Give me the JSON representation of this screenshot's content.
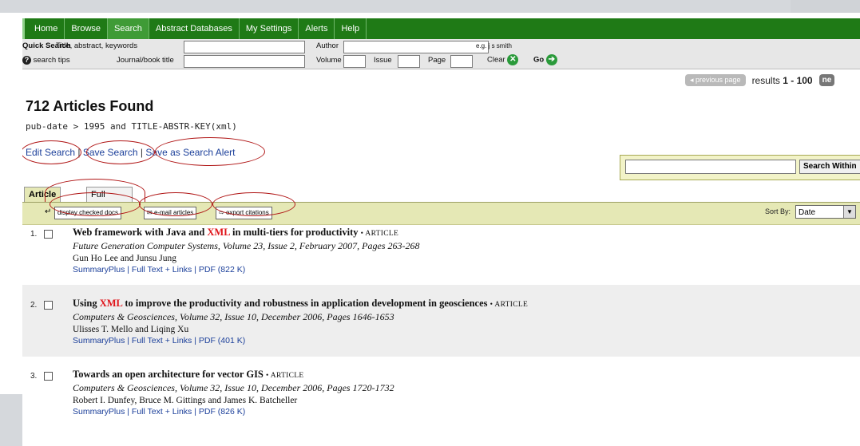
{
  "nav": {
    "items": [
      "Home",
      "Browse",
      "Search",
      "Abstract Databases",
      "My Settings",
      "Alerts",
      "Help"
    ],
    "active": "Search"
  },
  "quick_search": {
    "label": "Quick Search",
    "title_label": "Title, abstract, keywords",
    "author_label": "Author",
    "author_hint": "e.g. j s smith",
    "tips_label": "search tips",
    "journal_label": "Journal/book title",
    "volume_label": "Volume",
    "issue_label": "Issue",
    "page_label": "Page",
    "clear_label": "Clear",
    "go_label": "Go"
  },
  "pager": {
    "prev_label": "◂ previous page",
    "results_prefix": "results",
    "results_range": "1 - 100",
    "next_label": "ne"
  },
  "results_header": {
    "count_text": "712 Articles Found",
    "query_text": "pub-date > 1995 and TITLE-ABSTR-KEY(xml)"
  },
  "search_links": {
    "edit": "Edit Search",
    "save": "Save Search",
    "alert": "Save as Search Alert",
    "separator": "|"
  },
  "search_within": {
    "button_label": "Search Within"
  },
  "tabs": [
    "Article List",
    "Full Abstracts"
  ],
  "toolbar": {
    "display_checked": "display checked docs",
    "email": "e-mail articles",
    "export": "export citations",
    "sort_label": "Sort By:",
    "sort_value": "Date"
  },
  "results": [
    {
      "number": "1.",
      "title_before": "Web framework with Java and ",
      "title_highlight": "XML",
      "title_after": " in multi-tiers for productivity",
      "type": "• ARTICLE",
      "source": "Future Generation Computer Systems, Volume 23, Issue 2, February 2007, Pages 263-268",
      "authors": "Gun Ho Lee and Junsu Jung",
      "links": "SummaryPlus | Full Text + Links | PDF (822 K)"
    },
    {
      "number": "2.",
      "title_before": "Using ",
      "title_highlight": "XML",
      "title_after": " to improve the productivity and robustness in application development in geosciences",
      "type": "• ARTICLE",
      "source": "Computers & Geosciences, Volume 32, Issue 10, December 2006, Pages 1646-1653",
      "authors": "Ulisses T. Mello and Liqing Xu",
      "links": "SummaryPlus | Full Text + Links | PDF (401 K)"
    },
    {
      "number": "3.",
      "title_before": "Towards an open architecture for vector GIS",
      "title_highlight": "",
      "title_after": "",
      "type": "• ARTICLE",
      "source": "Computers & Geosciences, Volume 32, Issue 10, December 2006, Pages 1720-1732",
      "authors": "Robert I. Dunfey, Bruce M. Gittings and James K. Batcheller",
      "links": "SummaryPlus | Full Text + Links | PDF (826 K)"
    }
  ],
  "colors": {
    "nav_bg": "#1f7a16",
    "link_blue": "#1b3f9a",
    "highlight_red": "#e0141a",
    "annotation_circle": "#b01515"
  }
}
